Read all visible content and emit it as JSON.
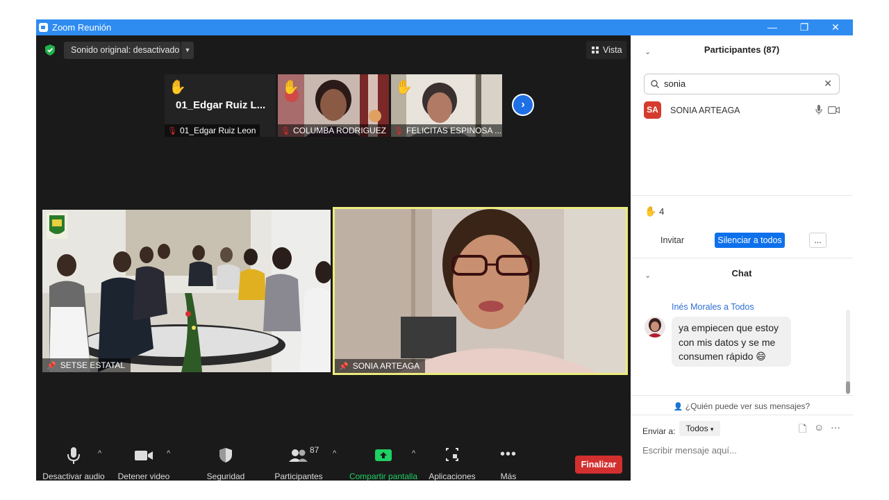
{
  "window": {
    "title": "Zoom Reunión",
    "controls": {
      "minimize": "—",
      "restore": "❐",
      "close": "✕"
    }
  },
  "meeting": {
    "sound_label": "Sonido original: desactivado",
    "view_label": "Vista",
    "thumbnails": [
      {
        "big_name": "01_Edgar Ruiz L...",
        "name": "01_Edgar Ruiz Leon",
        "hand_raised": true
      },
      {
        "name": "COLUMBA RODRIGUEZ",
        "hand_raised": true
      },
      {
        "name": "FELICITAS ESPINOSA ...",
        "hand_raised": true
      }
    ],
    "tiles": [
      {
        "name": "SETSE ESTATAL"
      },
      {
        "name": "SONIA ARTEAGA"
      }
    ],
    "colors": {
      "active_speaker_border": "#ecec7c",
      "end_button": "#d32f2f",
      "share_green": "#1fd065"
    }
  },
  "toolbar": {
    "audio_label": "Desactivar audio",
    "video_label": "Detener video",
    "security_label": "Seguridad",
    "participants_label": "Participantes",
    "participants_count": "87",
    "share_label": "Compartir pantalla",
    "apps_label": "Aplicaciones",
    "more_label": "Más",
    "end_label": "Finalizar"
  },
  "participants_panel": {
    "title": "Participantes (87)",
    "search_value": "sonia",
    "participants": [
      {
        "initials": "SA",
        "name": "SONIA ARTEAGA",
        "initials_color": "#d53b2e"
      }
    ],
    "raised_hands": "4",
    "invite_label": "Invitar",
    "mute_all_label": "Silenciar a todos",
    "more_label": "..."
  },
  "chat": {
    "title": "Chat",
    "messages": [
      {
        "from": "Inés Morales a Todos",
        "line1": "ya empiecen que estoy",
        "line2": "con mis datos y se me",
        "line3": "consumen rápido",
        "emoji": "😄"
      }
    ],
    "who_can_see": "¿Quién puede ver sus mensajes?",
    "send_to_label": "Enviar a:",
    "send_to_value": "Todos",
    "input_placeholder": "Escribir mensaje aquí..."
  }
}
